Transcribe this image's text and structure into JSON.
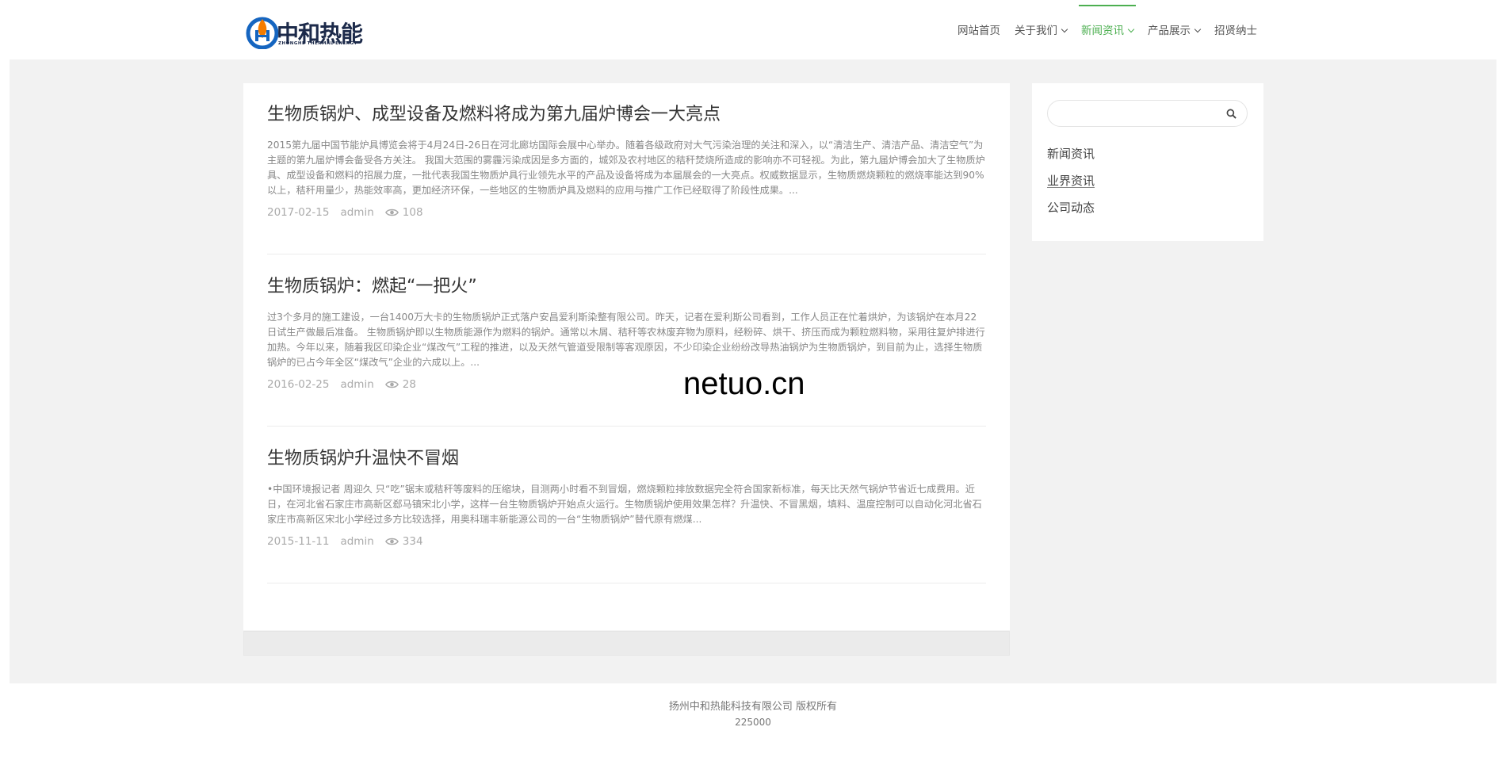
{
  "header": {
    "logo": {
      "text": "中和热能",
      "subtext": "ZHONGHE THERMAL ENERGY"
    },
    "nav": [
      {
        "label": "网站首页",
        "has_dropdown": false,
        "active": false
      },
      {
        "label": "关于我们",
        "has_dropdown": true,
        "active": false
      },
      {
        "label": "新闻资讯",
        "has_dropdown": true,
        "active": true
      },
      {
        "label": "产品展示",
        "has_dropdown": true,
        "active": false
      },
      {
        "label": "招贤纳士",
        "has_dropdown": false,
        "active": false
      }
    ]
  },
  "posts": [
    {
      "title": "生物质锅炉、成型设备及燃料将成为第九届炉博会一大亮点",
      "excerpt": "2015第九届中国节能炉具博览会将于4月24日-26日在河北廊坊国际会展中心举办。随着各级政府对大气污染治理的关注和深入，以“清洁生产、清洁产品、清洁空气”为主题的第九届炉博会备受各方关注。 我国大范围的雾霾污染成因是多方面的，城郊及农村地区的秸秆焚烧所造成的影响亦不可轻视。为此，第九届炉博会加大了生物质炉具、成型设备和燃料的招展力度，一批代表我国生物质炉具行业领先水平的产品及设备将成为本届展会的一大亮点。权威数据显示，生物质燃烧颗粒的燃烧率能达到90%以上，秸秆用量少，热能效率高，更加经济环保，一些地区的生物质炉具及燃料的应用与推广工作已经取得了阶段性成果。...",
      "date": "2017-02-15",
      "author": "admin",
      "views": "108"
    },
    {
      "title": "生物质锅炉：燃起“一把火”",
      "excerpt": "过3个多月的施工建设，一台1400万大卡的生物质锅炉正式落户安昌爱利斯染整有限公司。昨天，记者在爱利斯公司看到，工作人员正在忙着烘炉，为该锅炉在本月22日试生产做最后准备。 生物质锅炉即以生物质能源作为燃料的锅炉。通常以木屑、秸秆等农林废弃物为原料，经粉碎、烘干、挤压而成为颗粒燃料物，采用往复炉排进行加热。今年以来，随着我区印染企业“煤改气”工程的推进，以及天然气管道受限制等客观原因，不少印染企业纷纷改导热油锅炉为生物质锅炉，到目前为止，选择生物质锅炉的已占今年全区“煤改气”企业的六成以上。...",
      "date": "2016-02-25",
      "author": "admin",
      "views": "28"
    },
    {
      "title": "生物质锅炉升温快不冒烟",
      "excerpt": "•中国环境报记者 周迎久 只“吃”锯末或秸秆等废料的压缩块，目测两小时看不到冒烟，燃烧颗粒排放数据完全符合国家新标准，每天比天然气锅炉节省近七成费用。近日，在河北省石家庄市高新区郄马镇宋北小学，这样一台生物质锅炉开始点火运行。生物质锅炉使用效果怎样？升温快、不冒黑烟，填料、温度控制可以自动化河北省石家庄市高新区宋北小学经过多方比较选择，用奥科瑞丰新能源公司的一台“生物质锅炉”替代原有燃煤...",
      "date": "2015-11-11",
      "author": "admin",
      "views": "334"
    }
  ],
  "sidebar": {
    "search_placeholder": "",
    "links": [
      "新闻资讯",
      "业界资讯",
      "公司动态"
    ]
  },
  "watermark": "netuo.cn",
  "footer": {
    "copyright": "扬州中和热能科技有限公司 版权所有",
    "postcode": "225000"
  },
  "colors": {
    "accent": "#4caf50",
    "page_bg": "#f2f2f2",
    "logo_blue": "#1565c0",
    "logo_flame": "#f57c00"
  },
  "icons": [
    "logo-mark-icon",
    "chevron-down-icon",
    "eye-icon",
    "search-icon"
  ]
}
